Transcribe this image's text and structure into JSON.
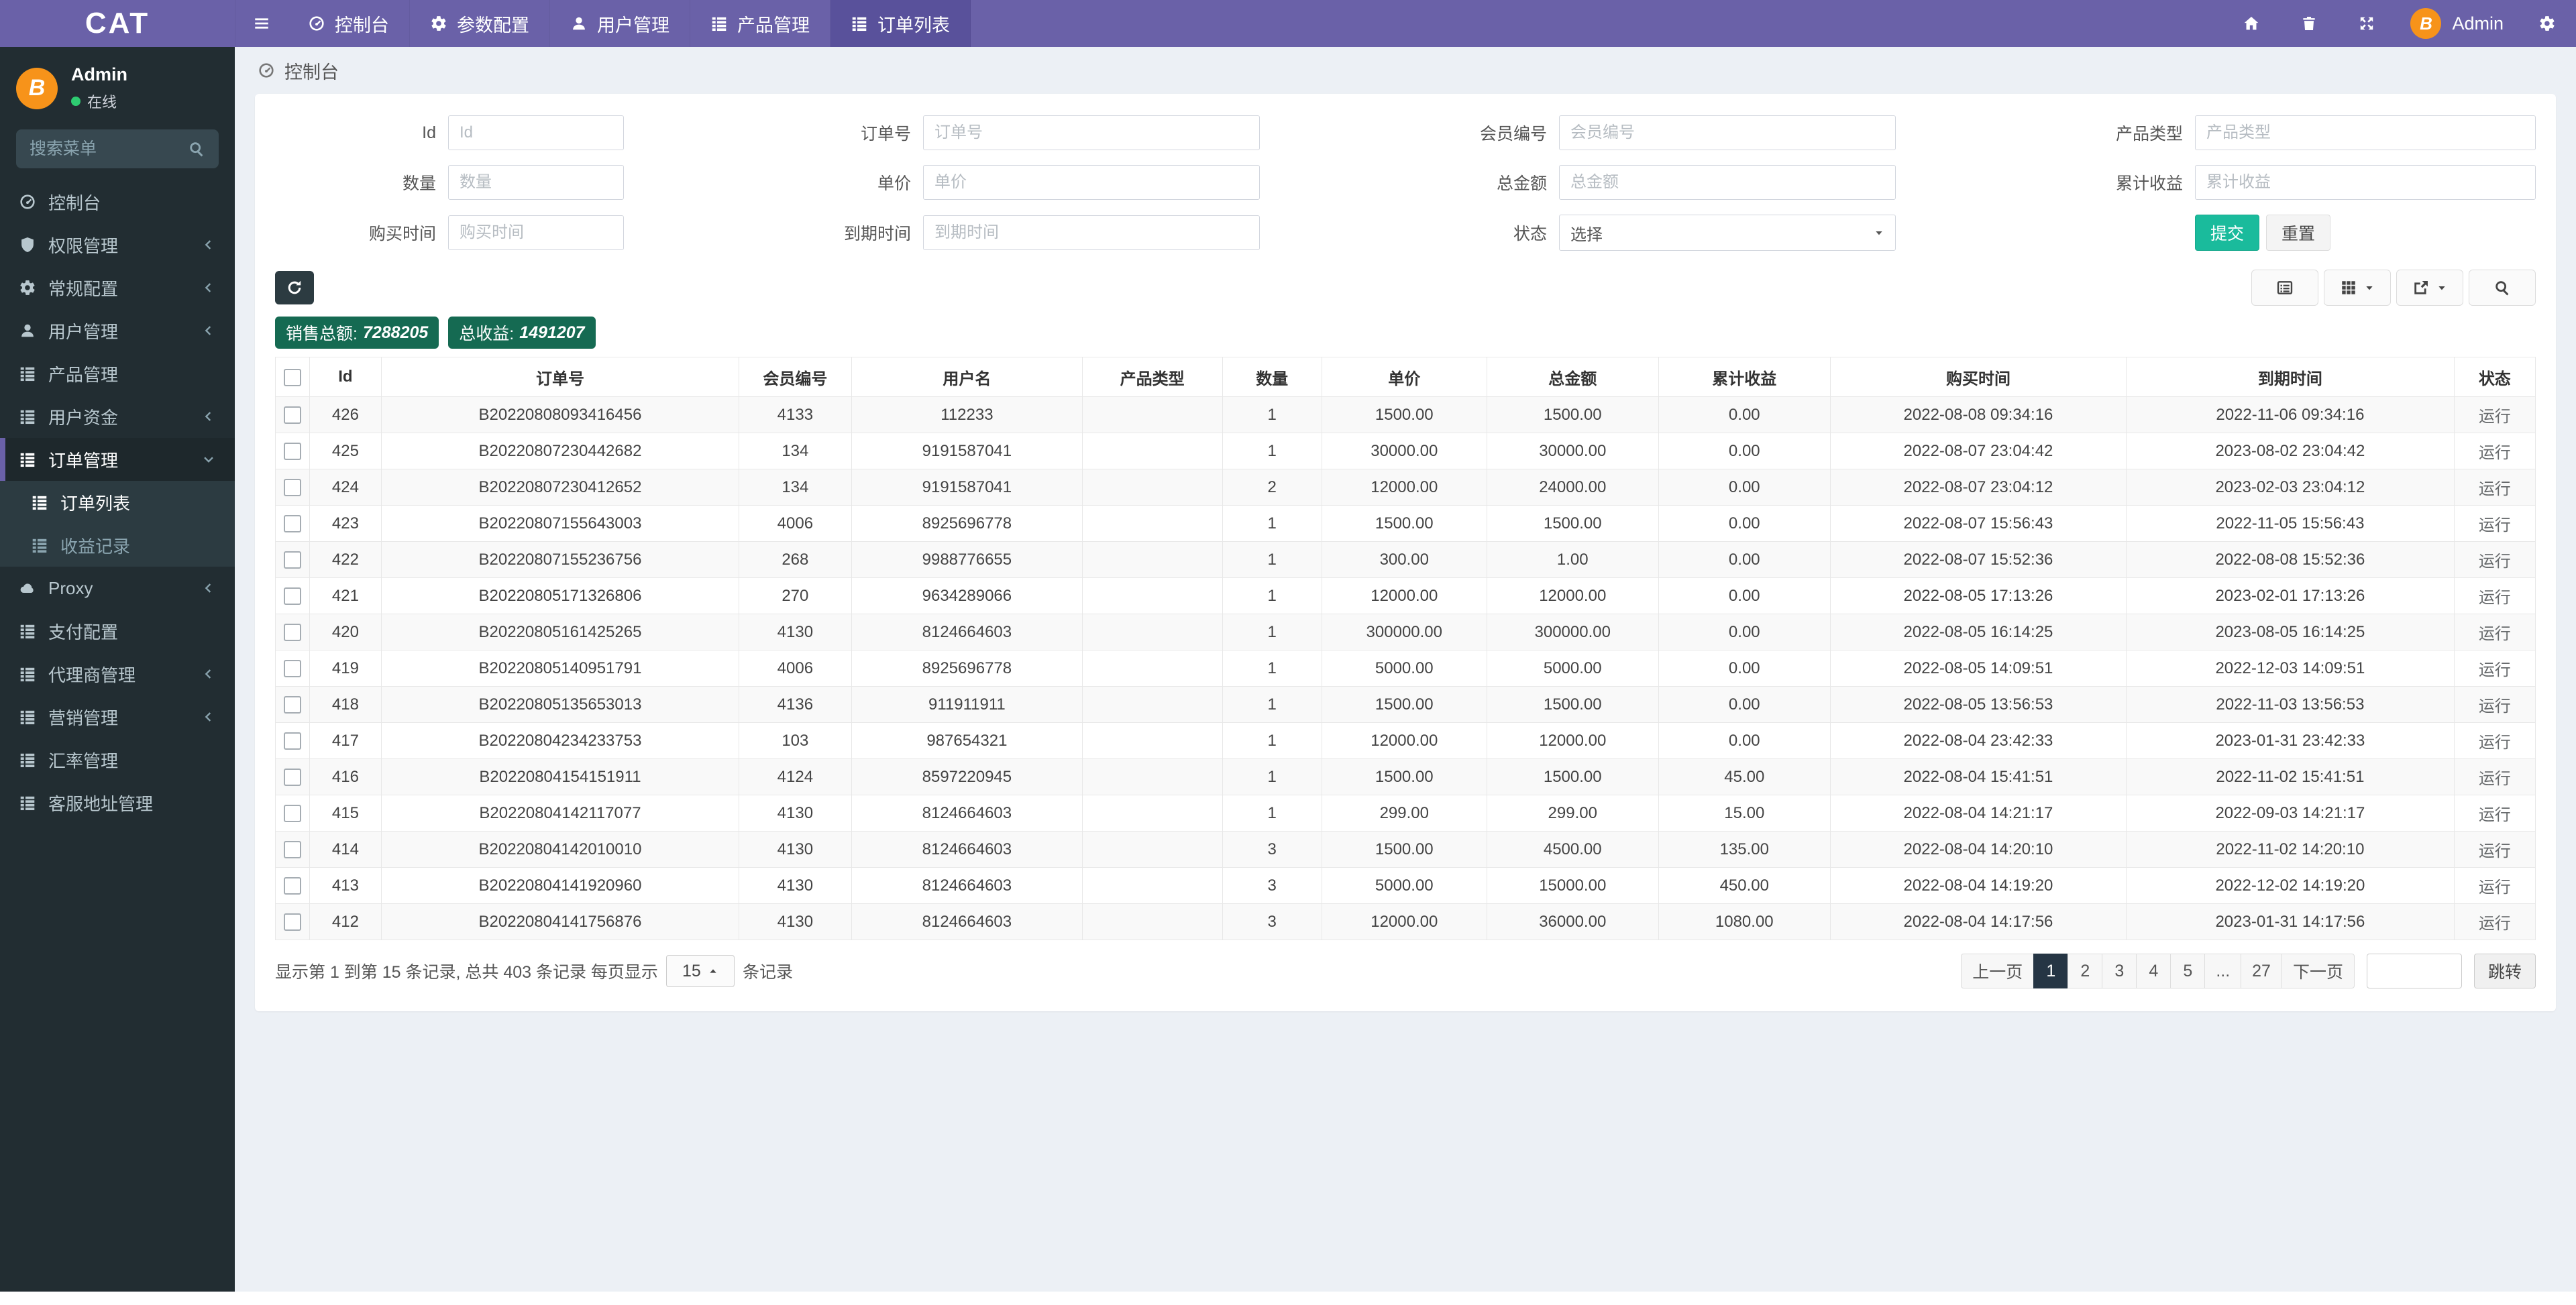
{
  "navbar": {
    "brand": "CAT",
    "menu": [
      {
        "name": "dashboard",
        "label": "控制台",
        "icon": "gauge",
        "active": false
      },
      {
        "name": "params-config",
        "label": "参数配置",
        "icon": "gear",
        "active": false
      },
      {
        "name": "user-management",
        "label": "用户管理",
        "icon": "user",
        "active": false
      },
      {
        "name": "product-management",
        "label": "产品管理",
        "icon": "list",
        "active": false
      },
      {
        "name": "order-list",
        "label": "订单列表",
        "icon": "list",
        "active": true
      }
    ],
    "admin_label": "Admin"
  },
  "sidebar": {
    "user": {
      "name": "Admin",
      "status": "在线"
    },
    "search_placeholder": "搜索菜单",
    "items": [
      {
        "name": "dashboard",
        "label": "控制台",
        "icon": "gauge",
        "chevron": "",
        "active": false
      },
      {
        "name": "permission-management",
        "label": "权限管理",
        "icon": "shield",
        "chevron": "left",
        "active": false
      },
      {
        "name": "general-config",
        "label": "常规配置",
        "icon": "gear",
        "chevron": "left",
        "active": false
      },
      {
        "name": "user-management",
        "label": "用户管理",
        "icon": "user",
        "chevron": "left",
        "active": false
      },
      {
        "name": "product-management",
        "label": "产品管理",
        "icon": "list",
        "chevron": "",
        "active": false
      },
      {
        "name": "user-funds",
        "label": "用户资金",
        "icon": "list",
        "chevron": "left",
        "active": false
      },
      {
        "name": "order-management",
        "label": "订单管理",
        "icon": "list",
        "chevron": "down",
        "active": true,
        "children": [
          {
            "name": "order-list",
            "label": "订单列表",
            "icon": "list",
            "active": true
          },
          {
            "name": "profit-records",
            "label": "收益记录",
            "icon": "list",
            "active": false
          }
        ]
      },
      {
        "name": "proxy",
        "label": "Proxy",
        "icon": "cloud",
        "chevron": "left",
        "active": false
      },
      {
        "name": "payment-config",
        "label": "支付配置",
        "icon": "list",
        "chevron": "",
        "active": false
      },
      {
        "name": "agent-management",
        "label": "代理商管理",
        "icon": "list",
        "chevron": "left",
        "active": false
      },
      {
        "name": "marketing-management",
        "label": "营销管理",
        "icon": "list",
        "chevron": "left",
        "active": false
      },
      {
        "name": "exchange-rate-management",
        "label": "汇率管理",
        "icon": "list",
        "chevron": "",
        "active": false
      },
      {
        "name": "service-address-management",
        "label": "客服地址管理",
        "icon": "list",
        "chevron": "",
        "active": false
      }
    ]
  },
  "breadcrumb": {
    "label": "控制台"
  },
  "filters": {
    "fields": [
      {
        "name": "id",
        "label": "Id",
        "placeholder": "Id",
        "type": "input"
      },
      {
        "name": "order-no",
        "label": "订单号",
        "placeholder": "订单号",
        "type": "input"
      },
      {
        "name": "member-no",
        "label": "会员编号",
        "placeholder": "会员编号",
        "type": "input"
      },
      {
        "name": "product-type",
        "label": "产品类型",
        "placeholder": "产品类型",
        "type": "input"
      },
      {
        "name": "quantity",
        "label": "数量",
        "placeholder": "数量",
        "type": "input"
      },
      {
        "name": "unit-price",
        "label": "单价",
        "placeholder": "单价",
        "type": "input"
      },
      {
        "name": "total-amount",
        "label": "总金额",
        "placeholder": "总金额",
        "type": "input"
      },
      {
        "name": "accumulated-profit",
        "label": "累计收益",
        "placeholder": "累计收益",
        "type": "input"
      },
      {
        "name": "buy-time",
        "label": "购买时间",
        "placeholder": "购买时间",
        "type": "input"
      },
      {
        "name": "expire-time",
        "label": "到期时间",
        "placeholder": "到期时间",
        "type": "input"
      },
      {
        "name": "status",
        "label": "状态",
        "value": "选择",
        "type": "select"
      }
    ],
    "submit_label": "提交",
    "reset_label": "重置"
  },
  "stats": {
    "sales": {
      "label": "销售总额:",
      "value": "7288205"
    },
    "profit": {
      "label": "总收益:",
      "value": "1491207"
    }
  },
  "table": {
    "columns": [
      "Id",
      "订单号",
      "会员编号",
      "用户名",
      "产品类型",
      "数量",
      "单价",
      "总金额",
      "累计收益",
      "购买时间",
      "到期时间",
      "状态"
    ],
    "rows": [
      [
        "426",
        "B20220808093416456",
        "4133",
        "112233",
        "",
        "1",
        "1500.00",
        "1500.00",
        "0.00",
        "2022-08-08 09:34:16",
        "2022-11-06 09:34:16",
        "运行"
      ],
      [
        "425",
        "B20220807230442682",
        "134",
        "9191587041",
        "",
        "1",
        "30000.00",
        "30000.00",
        "0.00",
        "2022-08-07 23:04:42",
        "2023-08-02 23:04:42",
        "运行"
      ],
      [
        "424",
        "B20220807230412652",
        "134",
        "9191587041",
        "",
        "2",
        "12000.00",
        "24000.00",
        "0.00",
        "2022-08-07 23:04:12",
        "2023-02-03 23:04:12",
        "运行"
      ],
      [
        "423",
        "B20220807155643003",
        "4006",
        "8925696778",
        "",
        "1",
        "1500.00",
        "1500.00",
        "0.00",
        "2022-08-07 15:56:43",
        "2022-11-05 15:56:43",
        "运行"
      ],
      [
        "422",
        "B20220807155236756",
        "268",
        "9988776655",
        "",
        "1",
        "300.00",
        "1.00",
        "0.00",
        "2022-08-07 15:52:36",
        "2022-08-08 15:52:36",
        "运行"
      ],
      [
        "421",
        "B20220805171326806",
        "270",
        "9634289066",
        "",
        "1",
        "12000.00",
        "12000.00",
        "0.00",
        "2022-08-05 17:13:26",
        "2023-02-01 17:13:26",
        "运行"
      ],
      [
        "420",
        "B20220805161425265",
        "4130",
        "8124664603",
        "",
        "1",
        "300000.00",
        "300000.00",
        "0.00",
        "2022-08-05 16:14:25",
        "2023-08-05 16:14:25",
        "运行"
      ],
      [
        "419",
        "B20220805140951791",
        "4006",
        "8925696778",
        "",
        "1",
        "5000.00",
        "5000.00",
        "0.00",
        "2022-08-05 14:09:51",
        "2022-12-03 14:09:51",
        "运行"
      ],
      [
        "418",
        "B20220805135653013",
        "4136",
        "911911911",
        "",
        "1",
        "1500.00",
        "1500.00",
        "0.00",
        "2022-08-05 13:56:53",
        "2022-11-03 13:56:53",
        "运行"
      ],
      [
        "417",
        "B20220804234233753",
        "103",
        "987654321",
        "",
        "1",
        "12000.00",
        "12000.00",
        "0.00",
        "2022-08-04 23:42:33",
        "2023-01-31 23:42:33",
        "运行"
      ],
      [
        "416",
        "B20220804154151911",
        "4124",
        "8597220945",
        "",
        "1",
        "1500.00",
        "1500.00",
        "45.00",
        "2022-08-04 15:41:51",
        "2022-11-02 15:41:51",
        "运行"
      ],
      [
        "415",
        "B20220804142117077",
        "4130",
        "8124664603",
        "",
        "1",
        "299.00",
        "299.00",
        "15.00",
        "2022-08-04 14:21:17",
        "2022-09-03 14:21:17",
        "运行"
      ],
      [
        "414",
        "B20220804142010010",
        "4130",
        "8124664603",
        "",
        "3",
        "1500.00",
        "4500.00",
        "135.00",
        "2022-08-04 14:20:10",
        "2022-11-02 14:20:10",
        "运行"
      ],
      [
        "413",
        "B20220804141920960",
        "4130",
        "8124664603",
        "",
        "3",
        "5000.00",
        "15000.00",
        "450.00",
        "2022-08-04 14:19:20",
        "2022-12-02 14:19:20",
        "运行"
      ],
      [
        "412",
        "B20220804141756876",
        "4130",
        "8124664603",
        "",
        "3",
        "12000.00",
        "36000.00",
        "1080.00",
        "2022-08-04 14:17:56",
        "2023-01-31 14:17:56",
        "运行"
      ]
    ]
  },
  "pagination": {
    "info_prefix": "显示第 1 到第 15 条记录, 总共 403 条记录 每页显示",
    "page_size": "15",
    "info_suffix": "条记录",
    "prev_label": "上一页",
    "pages": [
      "1",
      "2",
      "3",
      "4",
      "5",
      "...",
      "27"
    ],
    "active_page": "1",
    "next_label": "下一页",
    "jump_label": "跳转"
  }
}
